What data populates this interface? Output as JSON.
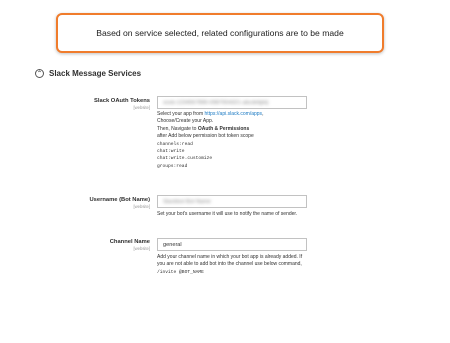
{
  "callout": {
    "text": "Based on service selected, related configurations are to be made"
  },
  "section": {
    "title": "Slack Message Services",
    "toggle_symbol": "⌃"
  },
  "fields": {
    "oauth": {
      "label": "Slack OAuth Tokens",
      "scope": "[website]",
      "value": "xoxb-1234567890-0987654321-abcdefghij"
    },
    "username": {
      "label": "Username (Bot Name)",
      "scope": "[website]",
      "value": "Slackbot Bot Name"
    },
    "channel": {
      "label": "Channel Name",
      "scope": "[website]",
      "value": "general"
    }
  },
  "oauth_note": {
    "line1_prefix": "Select your app from ",
    "line1_link": "https://api.slack.com/apps",
    "line1_suffix": ",",
    "line2": "Choose/Create your App.",
    "line3_prefix": "Then, Navigate to ",
    "line3_bold": "OAuth & Permissions",
    "line4": "after Add below permission bot token scope",
    "scopes": [
      "channels:read",
      "chat:write",
      "chat:write.customize",
      "groups:read"
    ]
  },
  "username_note": {
    "text": "Set your bot's username it will use to notify the name of sender."
  },
  "channel_note": {
    "text": "Add your channel name in which your bot app is already added. If you are not able to add bot into the channel use below command,",
    "command": "/invite @BOT_NAME"
  }
}
